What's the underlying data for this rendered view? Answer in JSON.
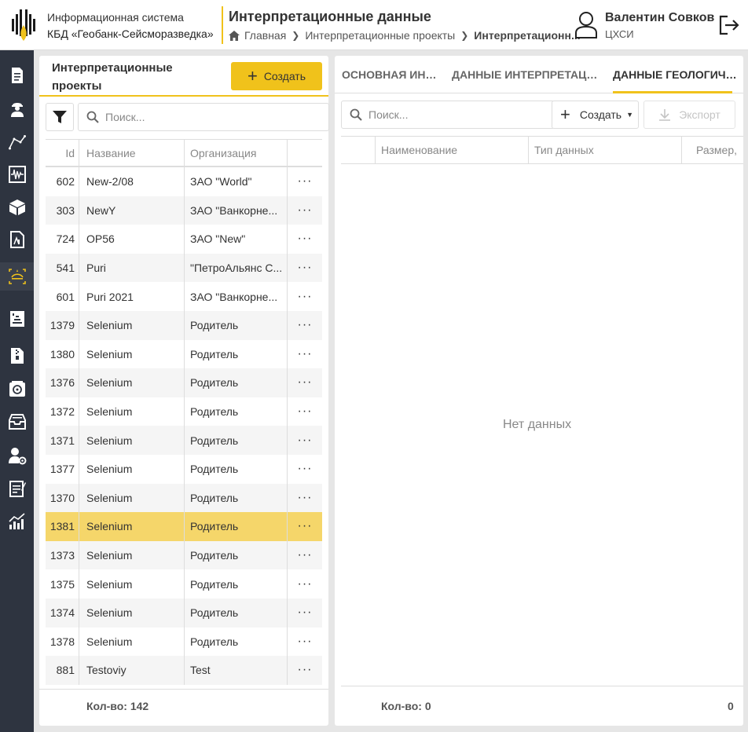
{
  "header": {
    "system_line1": "Информационная система",
    "system_line2": "КБД «Геобанк-Сейсморазведка»",
    "page_title": "Интерпретационные данные",
    "breadcrumb": {
      "home": "Главная",
      "projects": "Интерпретационные проекты",
      "current": "Интерпретационн..."
    },
    "user": {
      "name": "Валентин Совков",
      "org": "ЦХСИ"
    }
  },
  "sidebar": {
    "items": [
      {
        "icon": "document-list-icon"
      },
      {
        "icon": "worker-icon"
      },
      {
        "icon": "polyline-icon"
      },
      {
        "icon": "seismic-trace-icon"
      },
      {
        "icon": "cube-icon"
      },
      {
        "icon": "document-chart-icon"
      },
      {
        "icon": "interpretation-icon",
        "active": true
      },
      {
        "icon": "well-icon"
      },
      {
        "icon": "file-zip-icon"
      },
      {
        "icon": "disk-icon"
      },
      {
        "icon": "archive-icon"
      },
      {
        "icon": "user-settings-icon"
      },
      {
        "icon": "report-icon"
      },
      {
        "icon": "analytics-icon"
      }
    ]
  },
  "left_panel": {
    "title": "Интерпретационные проекты",
    "create_label": "Создать",
    "search_placeholder": "Поиск...",
    "columns": {
      "id": "Id",
      "name": "Название",
      "org": "Организация"
    },
    "rows": [
      {
        "id": "602",
        "name": "New-2/08",
        "org": "ЗАО \"World\""
      },
      {
        "id": "303",
        "name": "NewY",
        "org": "ЗАО \"Ванкорне..."
      },
      {
        "id": "724",
        "name": "OP56",
        "org": "ЗАО \"New\""
      },
      {
        "id": "541",
        "name": "Puri",
        "org": "\"ПетроАльянс С..."
      },
      {
        "id": "601",
        "name": "Puri 2021",
        "org": "ЗАО \"Ванкорне..."
      },
      {
        "id": "1379",
        "name": "Selenium",
        "org": "Родитель"
      },
      {
        "id": "1380",
        "name": "Selenium",
        "org": "Родитель"
      },
      {
        "id": "1376",
        "name": "Selenium",
        "org": "Родитель"
      },
      {
        "id": "1372",
        "name": "Selenium",
        "org": "Родитель"
      },
      {
        "id": "1371",
        "name": "Selenium",
        "org": "Родитель"
      },
      {
        "id": "1377",
        "name": "Selenium",
        "org": "Родитель"
      },
      {
        "id": "1370",
        "name": "Selenium",
        "org": "Родитель"
      },
      {
        "id": "1381",
        "name": "Selenium",
        "org": "Родитель",
        "selected": true
      },
      {
        "id": "1373",
        "name": "Selenium",
        "org": "Родитель"
      },
      {
        "id": "1375",
        "name": "Selenium",
        "org": "Родитель"
      },
      {
        "id": "1374",
        "name": "Selenium",
        "org": "Родитель"
      },
      {
        "id": "1378",
        "name": "Selenium",
        "org": "Родитель"
      },
      {
        "id": "881",
        "name": "Testoviy",
        "org": "Test"
      }
    ],
    "row_action": "···",
    "count_label": "Кол-во: 142"
  },
  "right_panel": {
    "tabs": [
      {
        "label": "ОСНОВНАЯ ИНФ..."
      },
      {
        "label": "ДАННЫЕ ИНТЕРПРЕТАЦИ..."
      },
      {
        "label": "ДАННЫЕ ГЕОЛОГИЧЕ...",
        "active": true
      }
    ],
    "search_placeholder": "Поиск...",
    "create_label": "Создать",
    "export_label": "Экспорт",
    "columns": {
      "name": "Наименование",
      "type": "Тип данных",
      "size": "Размер,"
    },
    "empty_text": "Нет данных",
    "count_label": "Кол-во: 0",
    "size_total": "0"
  },
  "colors": {
    "accent": "#f0c21b",
    "selected_row": "#f5d66a",
    "sidebar_bg": "#2e3440"
  }
}
